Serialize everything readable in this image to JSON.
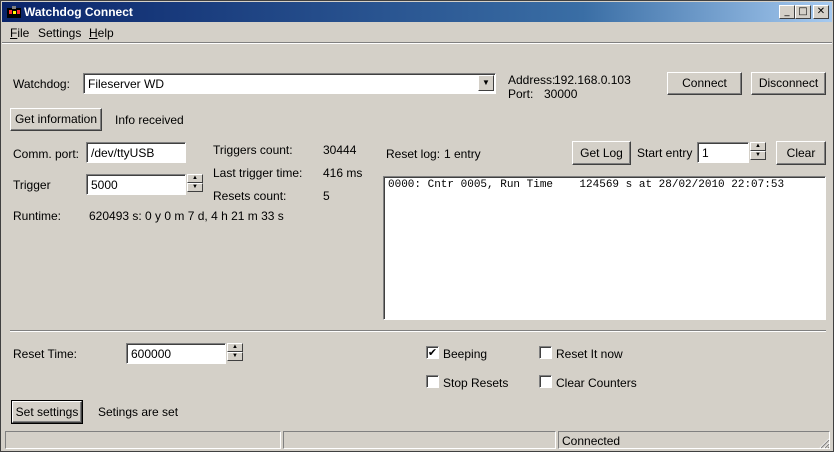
{
  "window": {
    "title": "Watchdog Connect"
  },
  "titlebar": {
    "minimize": "_",
    "maximize": "□",
    "close": "✕"
  },
  "menu": {
    "file": "F",
    "file_rest": "ile",
    "settings": "Settings",
    "help": "H",
    "help_rest": "elp"
  },
  "connection": {
    "watchdog_label": "Watchdog:",
    "watchdog_value": "Fileserver WD",
    "address_label": "Address:",
    "address_value": "192.168.0.103",
    "port_label": "Port:",
    "port_value": "30000",
    "connect_label": "Connect",
    "disconnect_label": "Disconnect"
  },
  "info": {
    "get_info_label": "Get information",
    "status": "Info received"
  },
  "params": {
    "comm_port_label": "Comm. port:",
    "comm_port_value": "/dev/ttyUSB",
    "trigger_label": "Trigger",
    "trigger_value": "5000",
    "runtime_label": "Runtime:",
    "runtime_value": "620493 s: 0 y 0 m 7 d, 4 h 21 m 33 s",
    "triggers_count_label": "Triggers count:",
    "triggers_count_value": "30444",
    "last_trigger_label": "Last trigger time:",
    "last_trigger_value": "416 ms",
    "resets_count_label": "Resets count:",
    "resets_count_value": "5"
  },
  "log": {
    "label": "Reset log:",
    "entries": "1 entry",
    "get_log_label": "Get Log",
    "start_entry_label": "Start entry",
    "start_entry_value": "1",
    "clear_label": "Clear",
    "lines": [
      "0000: Cntr 0005, Run Time    124569 s at 28/02/2010 22:07:53"
    ]
  },
  "settings": {
    "reset_time_label": "Reset Time:",
    "reset_time_value": "600000",
    "beeping_label": "Beeping",
    "beeping_checked": true,
    "reset_it_now_label": "Reset It now",
    "stop_resets_label": "Stop Resets",
    "clear_counters_label": "Clear Counters",
    "set_settings_label": "Set settings",
    "status": "Setings are set"
  },
  "statusbar": {
    "pane1": "",
    "pane2": "",
    "pane3": "Connected"
  },
  "icons": {
    "app": "watchdog-app-icon",
    "spin_up": "▲",
    "spin_down": "▼",
    "combo": "▼",
    "check": "✔"
  },
  "colors": {
    "titlebar_start": "#0a246a",
    "titlebar_end": "#a6caf0",
    "face": "#d4d0c8"
  }
}
